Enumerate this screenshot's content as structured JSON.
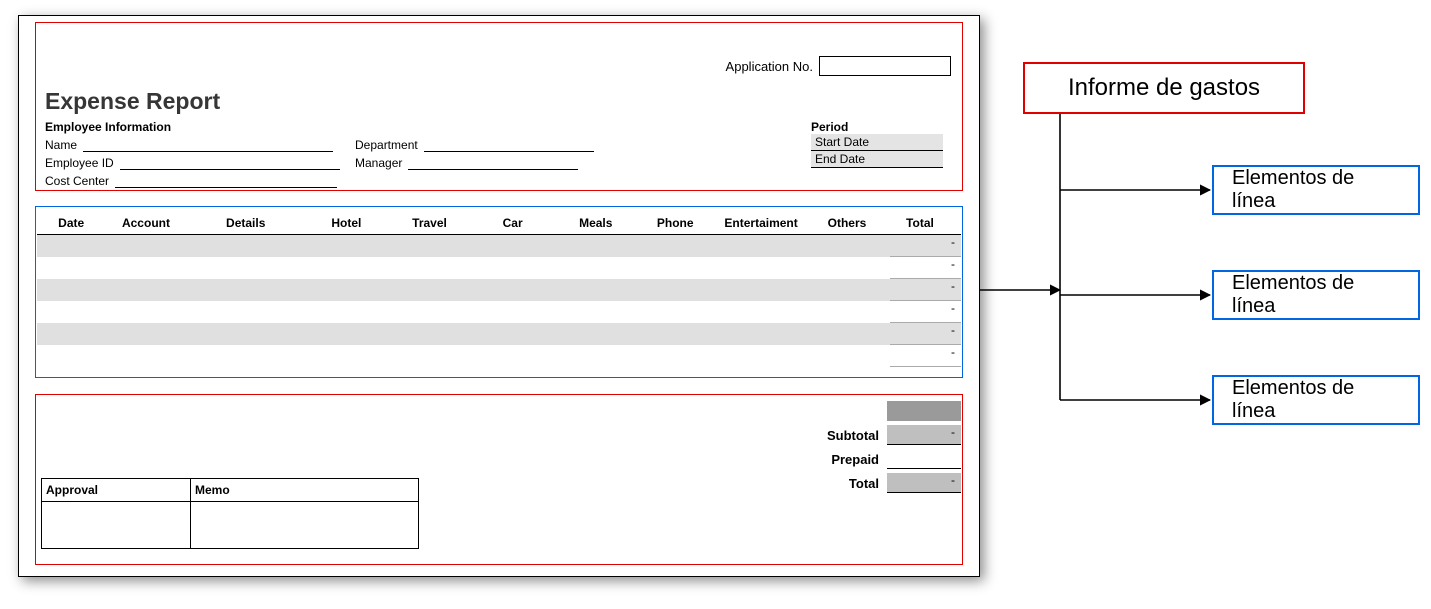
{
  "form": {
    "application_no_label": "Application No.",
    "title": "Expense Report",
    "employee_section_header": "Employee Information",
    "fields": {
      "name": "Name",
      "employee_id": "Employee ID",
      "cost_center": "Cost Center",
      "department": "Department",
      "manager": "Manager"
    },
    "period": {
      "header": "Period",
      "start": "Start Date",
      "end": "End Date"
    },
    "columns": {
      "date": "Date",
      "account": "Account",
      "details": "Details",
      "hotel": "Hotel",
      "travel": "Travel",
      "car": "Car",
      "meals": "Meals",
      "phone": "Phone",
      "entertainment": "Entertaiment",
      "others": "Others",
      "total": "Total"
    },
    "totals": {
      "subtotal": "Subtotal",
      "prepaid": "Prepaid",
      "total": "Total",
      "subtotal_value": "-",
      "prepaid_value": "",
      "total_value": "-"
    },
    "signature": {
      "approval": "Approval",
      "memo": "Memo"
    }
  },
  "diagram": {
    "root": "Informe de gastos",
    "child": "Elementos de línea"
  }
}
